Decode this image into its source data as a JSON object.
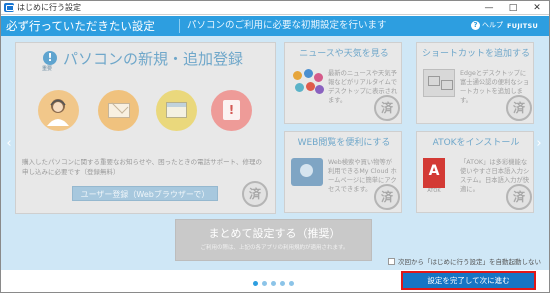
{
  "window": {
    "title": "はじめに行う設定",
    "minimize_glyph": "—",
    "maximize_glyph": "□",
    "close_glyph": "✕"
  },
  "header": {
    "title": "必ず行っていただきたい設定",
    "subtitle": "パソコンのご利用に必要な初期設定を行います",
    "help_label": "ヘルプ",
    "brand": "FUJITSU",
    "accent_color": "#2d9ee0"
  },
  "nav": {
    "prev_glyph": "‹",
    "next_glyph": "›"
  },
  "cards": {
    "register": {
      "title": "パソコンの新規・追加登録",
      "title_icon": "!",
      "title_icon_caption": "重要",
      "description": "購入したパソコンに関する重要なお知らせや、困ったときの電話サポート、修理の申し込みに必要です（登録無料）",
      "button_label": "ユーザー登録（Webブラウザーで）",
      "done_label": "済",
      "icons": [
        "support-person-icon",
        "mail-icon",
        "window-icon",
        "warning-icon"
      ],
      "warning_glyph": "!"
    },
    "news": {
      "title": "ニュースや天気を見る",
      "description": "最新のニュースや天気予報などがリアルタイムでデスクトップに表示されます。",
      "done_label": "済"
    },
    "shortcut": {
      "title": "ショートカットを追加する",
      "description": "Edgeとデスクトップに富士通公認の便利なショートカットを追加します。",
      "done_label": "済"
    },
    "web": {
      "title": "WEB閲覧を便利にする",
      "description": "Web検索や買い物等が利用できるMy Cloud ホームページに簡単にアクセスできます。",
      "done_label": "済"
    },
    "atok": {
      "title": "ATOKをインストール",
      "description": "「ATOK」は多彩機能な使いやすさ日本語入力システム。日本語入力が快適に。",
      "icon_letter": "A",
      "icon_caption": "ATOK",
      "done_label": "済"
    }
  },
  "bulk": {
    "title": "まとめて設定する（推奨）",
    "subtitle": "ご利用の際は、上記の各アプリの利用規約が適用されます。"
  },
  "footer": {
    "autostart_label": "次回から「はじめに行う設定」を自動起動しない",
    "pager_dots": 5,
    "pager_active_index": 0,
    "finish_button": "設定を完了して次に進む"
  }
}
